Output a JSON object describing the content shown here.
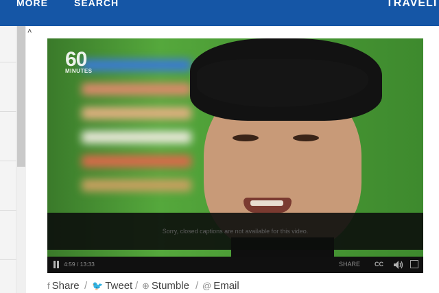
{
  "nav": {
    "more_label": "MORE",
    "search_label": "SEARCH",
    "brand_text": "TRAVELI"
  },
  "scrollbar": {
    "up_arrow": "˄"
  },
  "player": {
    "logo_number": "60",
    "logo_word": "MINUTES",
    "caption_message": "Sorry, closed captions are not available for this video.",
    "time_display": "4:59 / 13:33",
    "share_label": "SHARE",
    "cc_label": "CC",
    "icons": [
      "pause-icon",
      "volume-icon",
      "fullscreen-icon"
    ]
  },
  "share_bar": {
    "items": [
      {
        "icon": "f",
        "label": "Share"
      },
      {
        "icon": "🐦",
        "label": "Tweet"
      },
      {
        "icon": "⊕",
        "label": "Stumble"
      },
      {
        "icon": "@",
        "label": "Email"
      }
    ],
    "separator": "/"
  },
  "colors": {
    "nav_bg": "#1556a6",
    "nav_text": "#ffffff",
    "player_controls_bg": "#101010"
  }
}
